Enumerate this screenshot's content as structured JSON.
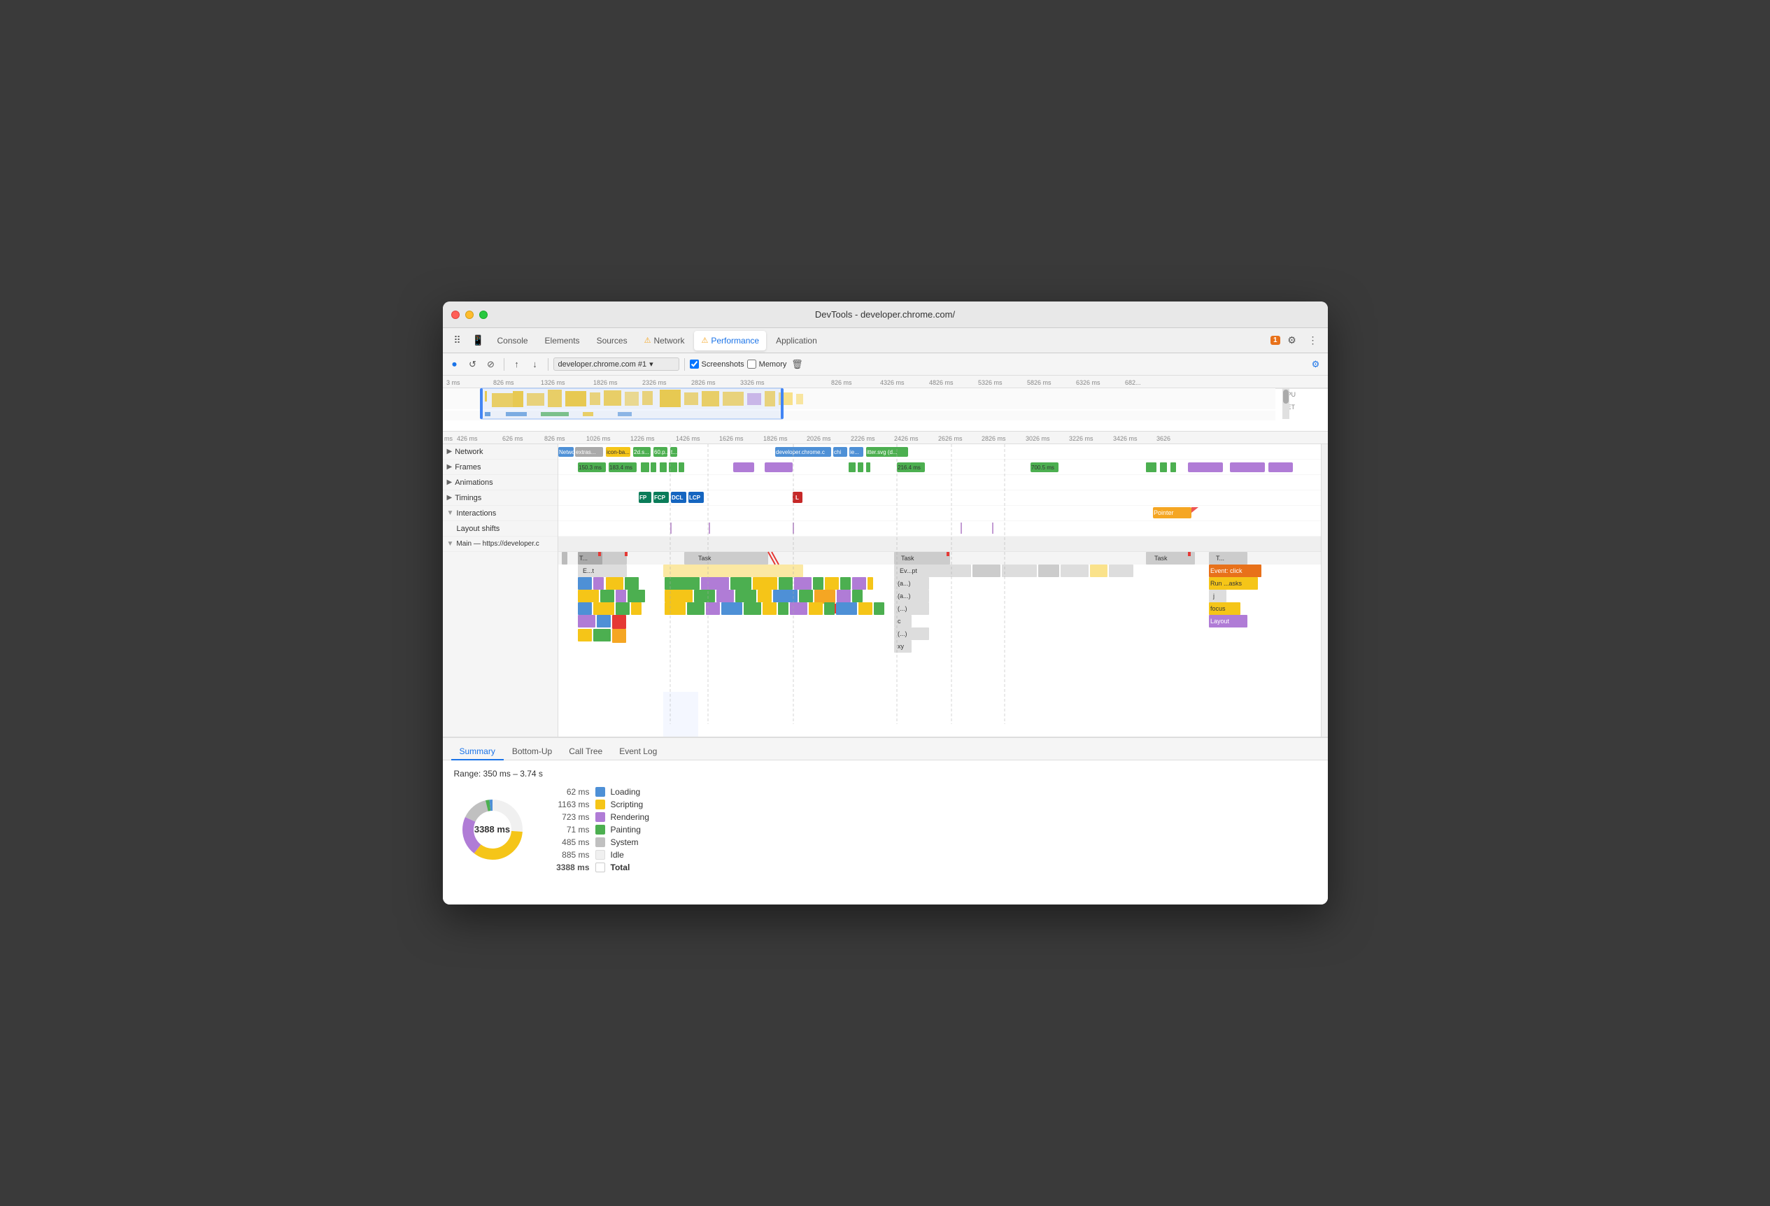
{
  "window": {
    "title": "DevTools - developer.chrome.com/"
  },
  "tabs": [
    {
      "label": "Console",
      "active": false,
      "warning": false
    },
    {
      "label": "Elements",
      "active": false,
      "warning": false
    },
    {
      "label": "Sources",
      "active": false,
      "warning": false
    },
    {
      "label": "Network",
      "active": false,
      "warning": true
    },
    {
      "label": "Performance",
      "active": true,
      "warning": true
    },
    {
      "label": "Application",
      "active": false,
      "warning": false
    }
  ],
  "toolbar": {
    "url": "developer.chrome.com #1",
    "screenshots_label": "Screenshots",
    "memory_label": "Memory"
  },
  "time_markers": [
    "3 ms",
    "826 ms",
    "1326 ms",
    "1826 ms",
    "2326 ms",
    "2826 ms",
    "3326 ms",
    "826 ms",
    "4326 ms",
    "4826 ms",
    "5326 ms",
    "5826 ms",
    "6326 ms",
    "682"
  ],
  "time_markers2": [
    "426 ms",
    "626 ms",
    "826 ms",
    "1026 ms",
    "1226 ms",
    "1426 ms",
    "1626 ms",
    "1826 ms",
    "2026 ms",
    "2226 ms",
    "2426 ms",
    "2626 ms",
    "2826 ms",
    "3026 ms",
    "3226 ms",
    "3426 ms",
    "3626"
  ],
  "tracks": {
    "network": "Network",
    "network_items": [
      "extras...",
      "icon-ba...",
      "2d.s...",
      "60.p...",
      "t...",
      "developer.chrome.c",
      "chi",
      "ie...",
      "itter.svg (d..."
    ],
    "frames": "Frames",
    "frame_times": [
      "150.3 ms",
      "183.4 ms",
      "216.4 ms",
      "700.5 ms"
    ],
    "animations": "Animations",
    "timings": "Timings",
    "timing_markers": [
      "FP",
      "FCP",
      "DCL",
      "LCP",
      "L"
    ],
    "interactions": "Interactions",
    "interactions_items": [
      "Pointer"
    ],
    "layout_shifts": "Layout shifts",
    "main_thread": "Main — https://developer.chrome.com/"
  },
  "main_thread_tasks": [
    "T...",
    "Task",
    "Task",
    "Task",
    "T...",
    "E...t",
    "Ev...pt",
    "Event: click",
    "(a...)",
    "Run ...asks",
    "(a...)",
    "j",
    "(...)",
    "focus",
    "c",
    "Layout",
    "(...)",
    "xy"
  ],
  "bottom_tabs": [
    "Summary",
    "Bottom-Up",
    "Call Tree",
    "Event Log"
  ],
  "summary": {
    "range": "Range: 350 ms – 3.74 s",
    "total_ms": "3388 ms",
    "items": [
      {
        "label": "Loading",
        "value": "62 ms",
        "color": "#4e90d6"
      },
      {
        "label": "Scripting",
        "value": "1163 ms",
        "color": "#f5c518"
      },
      {
        "label": "Rendering",
        "value": "723 ms",
        "color": "#b07cd6"
      },
      {
        "label": "Painting",
        "value": "71 ms",
        "color": "#4caf50"
      },
      {
        "label": "System",
        "value": "485 ms",
        "color": "#c0c0c0"
      },
      {
        "label": "Idle",
        "value": "885 ms",
        "color": "#f0f0f0"
      },
      {
        "label": "Total",
        "value": "3388 ms",
        "is_total": true
      }
    ]
  },
  "notification_count": "1"
}
